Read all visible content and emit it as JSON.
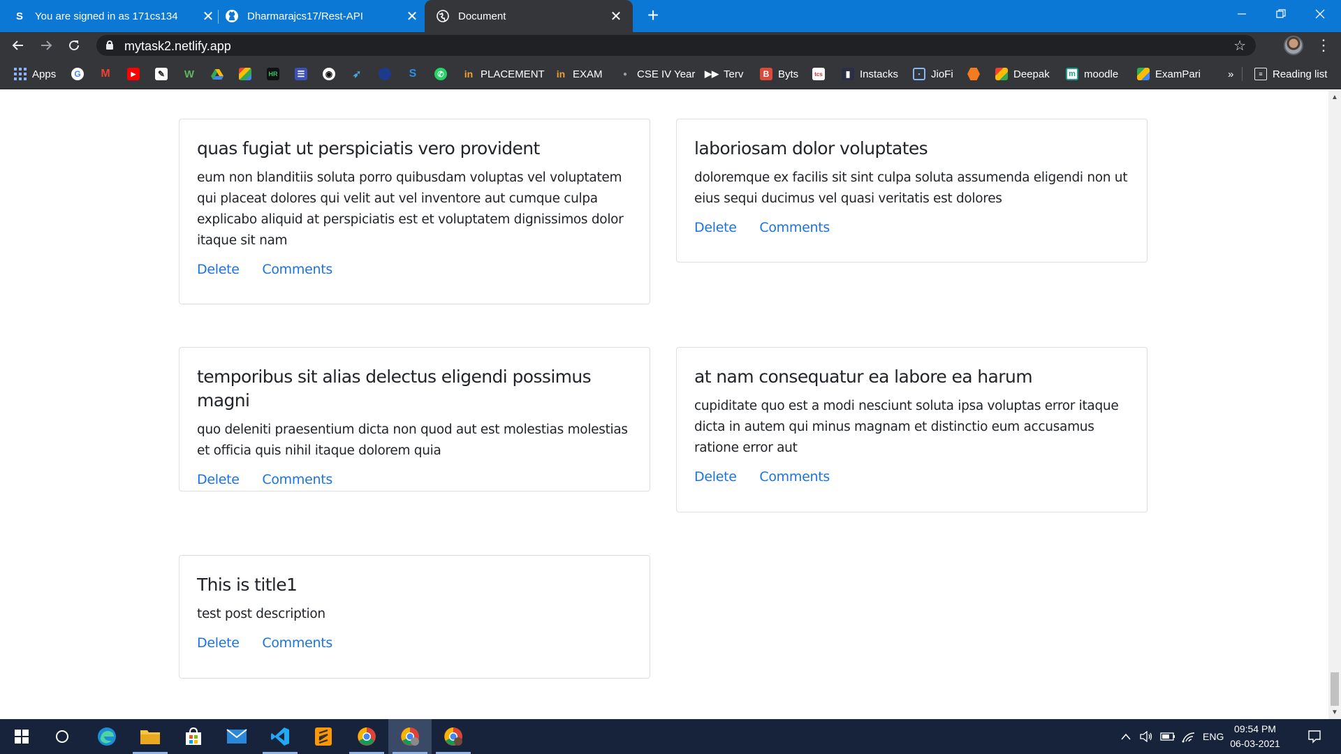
{
  "browser": {
    "tabs": [
      {
        "title": "You are signed in as 171cs134",
        "favicon": "S"
      },
      {
        "title": "Dharmarajcs17/Rest-API",
        "favicon": "github-icon"
      },
      {
        "title": "Document",
        "favicon": "globe-icon",
        "active": true
      }
    ],
    "url": "mytask2.netlify.app",
    "bookmarks": {
      "apps": "Apps",
      "placement": "PLACEMENT",
      "exam": "EXAM",
      "cse": "CSE IV Year",
      "terv": "Terv",
      "byts": "Byts",
      "instacks": "Instacks",
      "jiofi": "JioFi",
      "deepak": "Deepak",
      "moodle": "moodle",
      "exampari": "ExamPari",
      "more": "»",
      "reading_list": "Reading list"
    }
  },
  "posts": [
    {
      "title": "quas fugiat ut perspiciatis vero provident",
      "body": "eum non blanditiis soluta porro quibusdam voluptas vel voluptatem qui placeat dolores qui velit aut vel inventore aut cumque culpa explicabo aliquid at perspiciatis est et voluptatem dignissimos dolor itaque sit nam",
      "delete_label": "Delete",
      "comments_label": "Comments"
    },
    {
      "title": "laboriosam dolor voluptates",
      "body": "doloremque ex facilis sit sint culpa soluta assumenda eligendi non ut eius sequi ducimus vel quasi veritatis est dolores",
      "delete_label": "Delete",
      "comments_label": "Comments"
    },
    {
      "title": "temporibus sit alias delectus eligendi possimus magni",
      "body": "quo deleniti praesentium dicta non quod aut est molestias molestias et officia quis nihil itaque dolorem quia",
      "delete_label": "Delete",
      "comments_label": "Comments"
    },
    {
      "title": "at nam consequatur ea labore ea harum",
      "body": "cupiditate quo est a modi nesciunt soluta ipsa voluptas error itaque dicta in autem qui minus magnam et distinctio eum accusamus ratione error aut",
      "delete_label": "Delete",
      "comments_label": "Comments"
    },
    {
      "title": "This is title1",
      "body": "test post description",
      "delete_label": "Delete",
      "comments_label": "Comments"
    }
  ],
  "taskbar": {
    "language": "ENG",
    "time": "09:54 PM",
    "date": "06-03-2021"
  },
  "colors": {
    "titlebar": "#0a78d4",
    "toolbar": "#35363a",
    "link": "#1a73e8",
    "taskbar": "#17233a"
  }
}
